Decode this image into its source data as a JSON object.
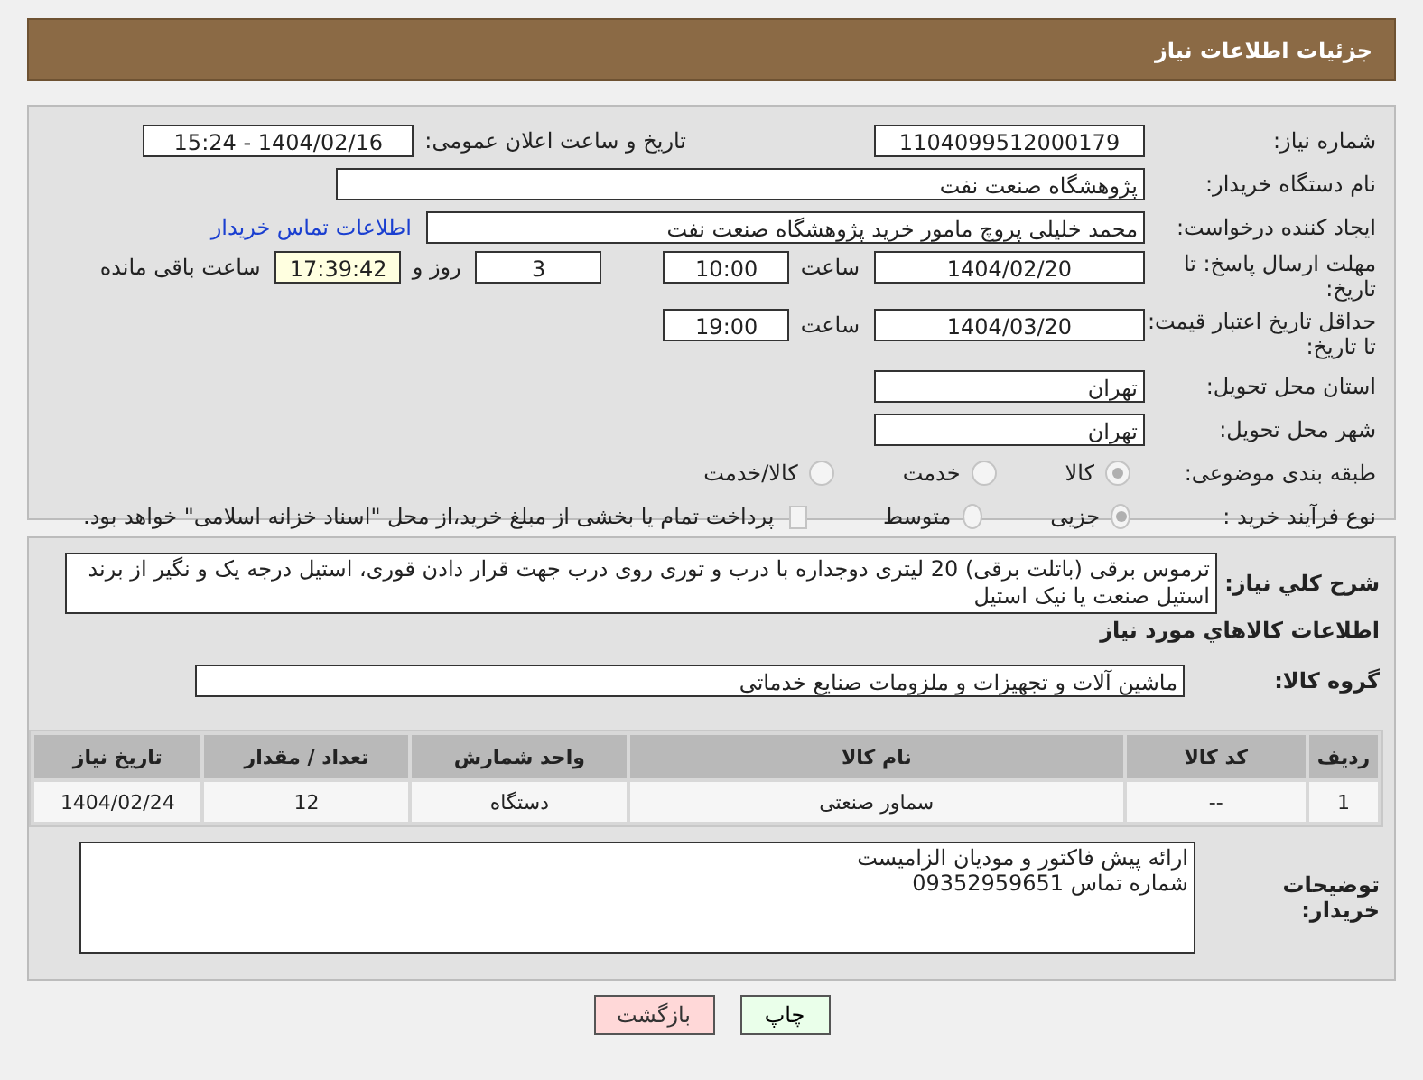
{
  "header": {
    "title": "جزئیات اطلاعات نیاز"
  },
  "need_number": {
    "label": "شماره نیاز:",
    "value": "1104099512000179"
  },
  "announce": {
    "label": "تاریخ و ساعت اعلان عمومی:",
    "value": "1404/02/16 - 15:24"
  },
  "buyer_org": {
    "label": "نام دستگاه خریدار:",
    "value": "پژوهشگاه صنعت نفت"
  },
  "requester": {
    "label": "ایجاد کننده درخواست:",
    "value": "محمد خلیلی پروچ مامور خرید پژوهشگاه صنعت نفت",
    "link": "اطلاعات تماس خریدار"
  },
  "reply_deadline": {
    "label": "مهلت ارسال پاسخ: تا تاریخ:",
    "date": "1404/02/20",
    "time_label": "ساعت",
    "time": "10:00",
    "days": "3",
    "days_label": "روز و",
    "remaining": "17:39:42",
    "remaining_label": "ساعت باقی مانده"
  },
  "price_validity": {
    "label": "حداقل تاریخ اعتبار قیمت: تا تاریخ:",
    "date": "1404/03/20",
    "time_label": "ساعت",
    "time": "19:00"
  },
  "province": {
    "label": "استان محل تحویل:",
    "value": "تهران"
  },
  "city": {
    "label": "شهر محل تحویل:",
    "value": "تهران"
  },
  "category": {
    "label": "طبقه بندی موضوعی:",
    "options": [
      {
        "label": "کالا",
        "selected": true
      },
      {
        "label": "خدمت",
        "selected": false
      },
      {
        "label": "کالا/خدمت",
        "selected": false
      }
    ]
  },
  "process": {
    "label": "نوع فرآیند خرید :",
    "options": [
      {
        "label": "جزیی",
        "selected": true
      },
      {
        "label": "متوسط",
        "selected": false
      }
    ],
    "checkbox": {
      "label": "پرداخت تمام یا بخشی از مبلغ خرید،از محل \"اسناد خزانه اسلامی\" خواهد بود.",
      "checked": false
    }
  },
  "description": {
    "label": "شرح کلي نياز:",
    "value": "ترموس برقی (باتلت برقی) 20 لیتری دوجداره با درب و توری روی درب جهت قرار دادن قوری، استیل درجه یک و نگیر از برند استیل صنعت یا نیک استیل"
  },
  "goods_heading": "اطلاعات کالاهاي مورد نياز",
  "goods_group": {
    "label": "گروه کالا:",
    "value": "ماشین آلات و تجهیزات و ملزومات صنایع خدماتی"
  },
  "table": {
    "columns": [
      "ردیف",
      "کد کالا",
      "نام کالا",
      "واحد شمارش",
      "تعداد / مقدار",
      "تاریخ نیاز"
    ],
    "rows": [
      [
        "1",
        "--",
        "سماور صنعتی",
        "دستگاه",
        "12",
        "1404/02/24"
      ]
    ]
  },
  "buyer_notes": {
    "label": "توضیحات خریدار:",
    "lines": [
      "ارائه پیش فاکتور و مودیان الزامیست",
      "شماره تماس 09352959651"
    ]
  },
  "buttons": [
    {
      "label": "چاپ",
      "kind": "print"
    },
    {
      "label": "بازگشت",
      "kind": "back"
    }
  ]
}
